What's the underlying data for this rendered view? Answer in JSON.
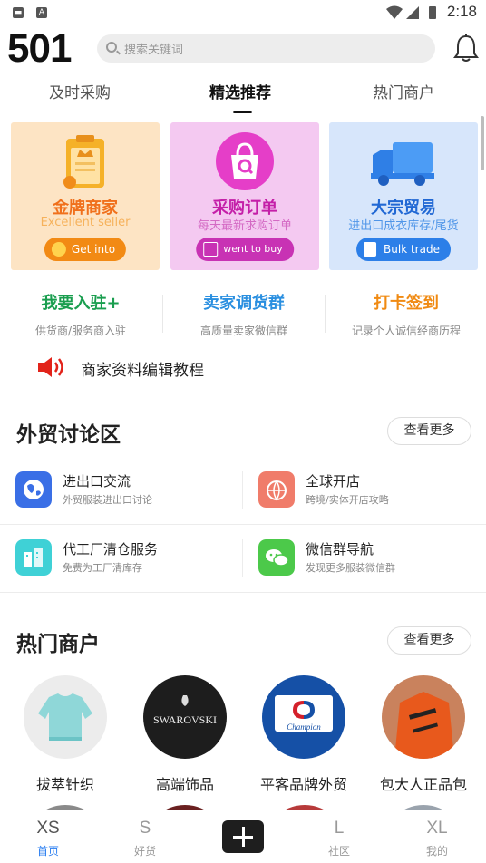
{
  "status_bar": {
    "time": "2:18"
  },
  "header": {
    "logo": "501",
    "search_placeholder": "搜索关键词"
  },
  "tabs": [
    {
      "label": "及时采购"
    },
    {
      "label": "精选推荐"
    },
    {
      "label": "热门商户"
    }
  ],
  "banners": [
    {
      "title": "金牌商家",
      "subtitle": "Excellent seller",
      "button": "Get into",
      "color": "#f0701c"
    },
    {
      "title": "采购订单",
      "subtitle": "每天最新求购订单",
      "button": "went to buy",
      "color": "#c41fa8"
    },
    {
      "title": "大宗贸易",
      "subtitle": "进出口成衣库存/尾货",
      "button": "Bulk trade",
      "color": "#2c7fe8"
    }
  ],
  "quick_links": [
    {
      "title": "我要入驻+",
      "subtitle": "供货商/服务商入驻",
      "color": "#1a9e4f"
    },
    {
      "title": "卖家调货群",
      "subtitle": "高质量卖家微信群",
      "color": "#2a8fe0"
    },
    {
      "title": "打卡签到",
      "subtitle": "记录个人诚信经商历程",
      "color": "#f08a12"
    }
  ],
  "notice": {
    "text": "商家资料编辑教程"
  },
  "forum": {
    "title": "外贸讨论区",
    "more": "查看更多",
    "items": [
      {
        "title": "进出口交流",
        "subtitle": "外贸服装进出口讨论",
        "icon": "globe-icon",
        "color": "#3a6fe6"
      },
      {
        "title": "全球开店",
        "subtitle": "跨境/实体开店攻略",
        "icon": "globe-shop-icon",
        "color": "#f07c6a"
      },
      {
        "title": "代工厂清仓服务",
        "subtitle": "免费为工厂清库存",
        "icon": "factory-icon",
        "color": "#3fd1d6"
      },
      {
        "title": "微信群导航",
        "subtitle": "发现更多服装微信群",
        "icon": "wechat-icon",
        "color": "#4cc94a"
      }
    ]
  },
  "merchants": {
    "title": "热门商户",
    "more": "查看更多",
    "items": [
      {
        "name": "拔萃针织"
      },
      {
        "name": "高端饰品",
        "logo_text": "SWAROVSKI"
      },
      {
        "name": "平客品牌外贸",
        "logo_text": "Champion"
      },
      {
        "name": "包大人正品包"
      }
    ]
  },
  "bottom_nav": [
    {
      "abbr": "XS",
      "label": "首页",
      "active": true
    },
    {
      "abbr": "S",
      "label": "好货",
      "active": false
    },
    {
      "abbr": "L",
      "label": "社区",
      "active": false
    },
    {
      "abbr": "XL",
      "label": "我的",
      "active": false
    }
  ]
}
